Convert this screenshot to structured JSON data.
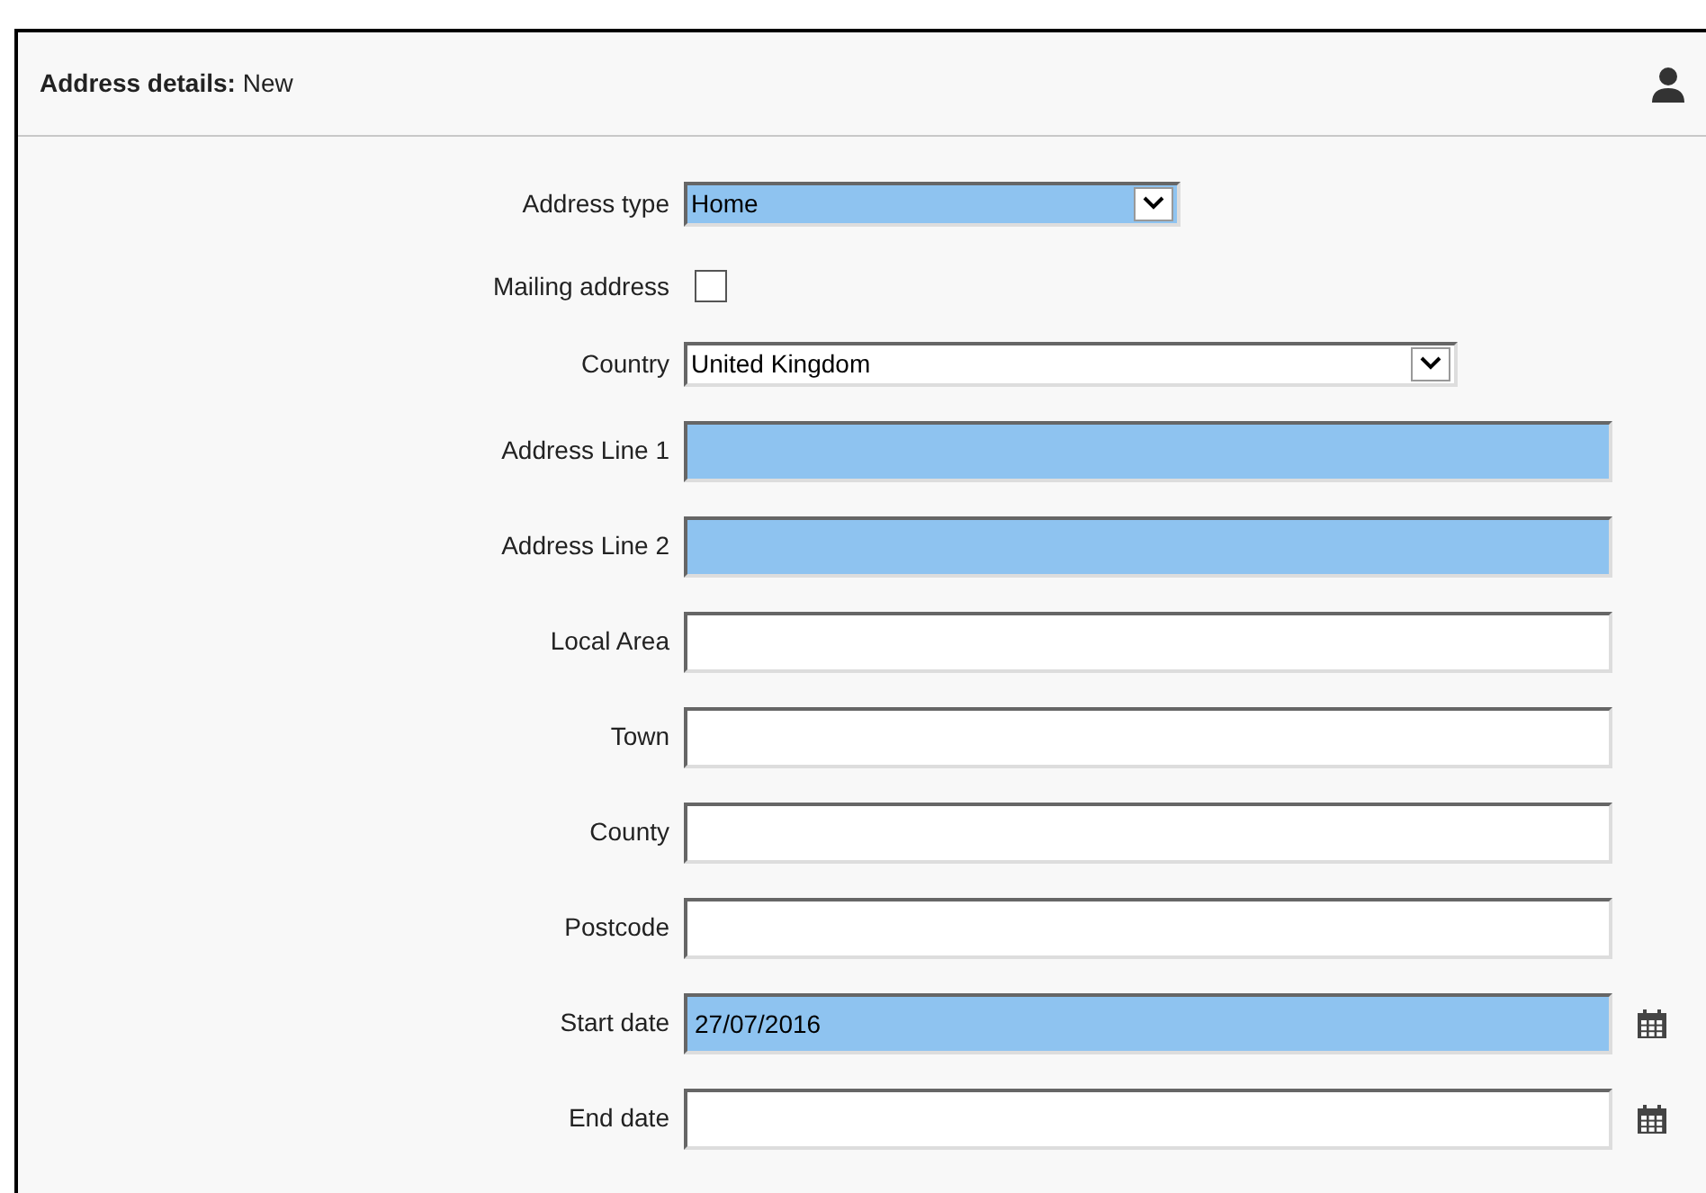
{
  "header": {
    "title": "Address details:",
    "subtitle": "New"
  },
  "fields": [
    {
      "kind": "select",
      "label": "Address type",
      "value": "Home",
      "required": true,
      "wide": false
    },
    {
      "kind": "checkbox",
      "label": "Mailing address",
      "checked": false
    },
    {
      "kind": "select",
      "label": "Country",
      "value": "United Kingdom",
      "required": false,
      "wide": true
    },
    {
      "kind": "text",
      "label": "Address Line 1",
      "required": true
    },
    {
      "kind": "text",
      "label": "Address Line 2",
      "required": true
    },
    {
      "kind": "text",
      "label": "Local Area",
      "required": false
    },
    {
      "kind": "text",
      "label": "Town",
      "required": false
    },
    {
      "kind": "text",
      "label": "County",
      "required": false
    },
    {
      "kind": "text",
      "label": "Postcode",
      "required": false
    },
    {
      "kind": "date",
      "label": "Start date",
      "value": "27/07/2016",
      "required": true
    },
    {
      "kind": "date",
      "label": "End date",
      "required": false
    }
  ]
}
